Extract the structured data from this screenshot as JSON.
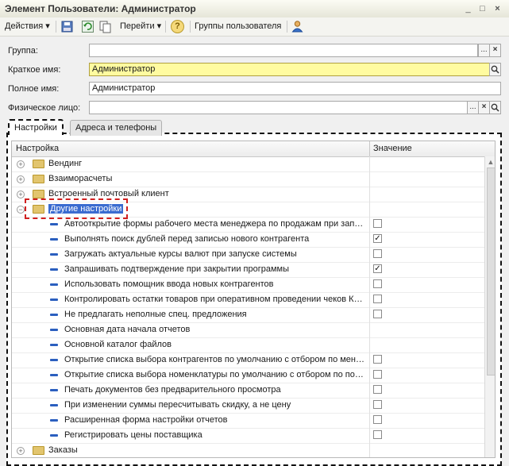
{
  "window": {
    "title": "Элемент Пользователи: Администратор",
    "controls": [
      "_",
      "□",
      "×"
    ]
  },
  "toolbar": {
    "actions_label": "Действия",
    "goto_label": "Перейти",
    "help_label": "?",
    "groups_label": "Группы пользователя"
  },
  "form": {
    "group_label": "Группа:",
    "group_value": "",
    "short_name_label": "Краткое имя:",
    "short_name_value": "Администратор",
    "full_name_label": "Полное имя:",
    "full_name_value": "Администратор",
    "person_label": "Физическое лицо:",
    "person_value": "",
    "btn_dots": "...",
    "btn_clear": "×",
    "btn_search": "Q"
  },
  "tabs": [
    "Настройки",
    "Адреса и телефоны"
  ],
  "grid": {
    "col_setting": "Настройка",
    "col_value": "Значение",
    "rows": [
      {
        "type": "group",
        "label": "Вендинг",
        "expanded": false
      },
      {
        "type": "group",
        "label": "Взаиморасчеты",
        "expanded": false
      },
      {
        "type": "group",
        "label": "Встроенный почтовый клиент",
        "expanded": false
      },
      {
        "type": "group",
        "label": "Другие настройки",
        "expanded": true,
        "selected": true
      },
      {
        "type": "item",
        "label": "Автооткрытие формы рабочего места менеджера по продажам при зап…",
        "checkbox": true,
        "checked": false
      },
      {
        "type": "item",
        "label": "Выполнять поиск дублей перед записью нового контрагента",
        "checkbox": true,
        "checked": true
      },
      {
        "type": "item",
        "label": "Загружать актуальные курсы валют при запуске системы",
        "checkbox": true,
        "checked": false
      },
      {
        "type": "item",
        "label": "Запрашивать подтверждение при закрытии программы",
        "checkbox": true,
        "checked": true
      },
      {
        "type": "item",
        "label": "Использовать помощник ввода новых контрагентов",
        "checkbox": true,
        "checked": false
      },
      {
        "type": "item",
        "label": "Контролировать остатки товаров при оперативном проведении чеков К…",
        "checkbox": true,
        "checked": false
      },
      {
        "type": "item",
        "label": "Не предлагать неполные спец. предложения",
        "checkbox": true,
        "checked": false
      },
      {
        "type": "item",
        "label": "Основная дата начала отчетов",
        "checkbox": false
      },
      {
        "type": "item",
        "label": "Основной каталог файлов",
        "checkbox": false
      },
      {
        "type": "item",
        "label": "Открытие списка выбора контрагентов по умолчанию с отбором по мен…",
        "checkbox": true,
        "checked": false
      },
      {
        "type": "item",
        "label": "Открытие списка выбора номенклатуры по умолчанию с отбором по по…",
        "checkbox": true,
        "checked": false
      },
      {
        "type": "item",
        "label": "Печать документов без предварительного просмотра",
        "checkbox": true,
        "checked": false
      },
      {
        "type": "item",
        "label": "При изменении суммы пересчитывать скидку, а не цену",
        "checkbox": true,
        "checked": false
      },
      {
        "type": "item",
        "label": "Расширенная форма настройки отчетов",
        "checkbox": true,
        "checked": false
      },
      {
        "type": "item",
        "label": "Регистрировать цены поставщика",
        "checkbox": true,
        "checked": false
      },
      {
        "type": "group",
        "label": "Заказы",
        "expanded": false
      }
    ]
  },
  "colors": {
    "selection": "#3a6bd0",
    "highlight_field": "#fffba0",
    "dash_highlight": "#d02020"
  }
}
